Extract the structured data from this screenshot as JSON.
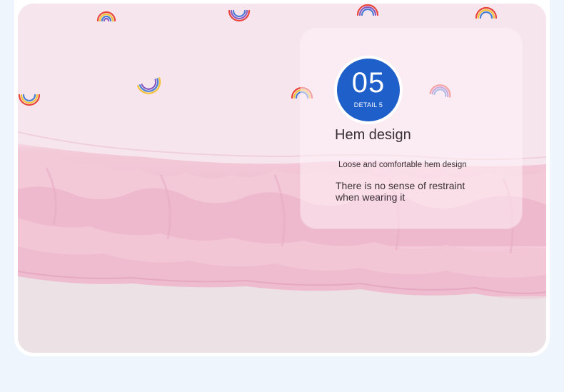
{
  "detail": {
    "number": "05",
    "label": "DETAIL 5",
    "title": "Hem design",
    "description_small": "Loose and comfortable hem design",
    "description_main": "There is no sense of restraint when wearing it"
  },
  "colors": {
    "badge": "#1f5fc9",
    "fabric_top": "#f7e4ec",
    "ruffle": "#f1c3d4",
    "page_background": "#eef5fd"
  }
}
